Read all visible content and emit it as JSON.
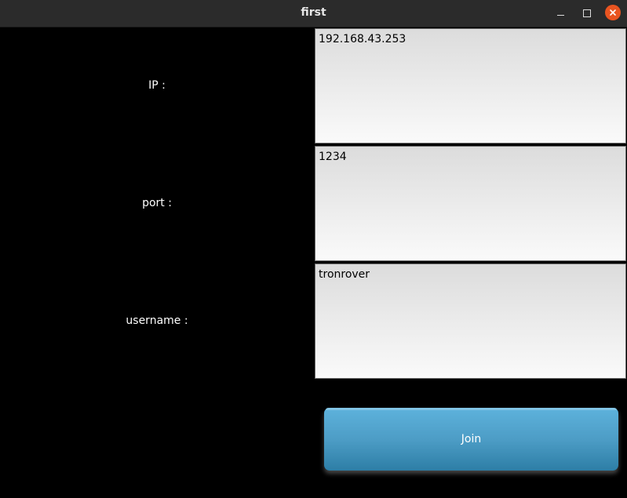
{
  "window": {
    "title": "first"
  },
  "form": {
    "ip_label": "IP :",
    "ip_value": "192.168.43.253",
    "port_label": "port :",
    "port_value": "1234",
    "username_label": "username :",
    "username_value": "tronrover",
    "join_label": "Join"
  },
  "colors": {
    "close_button": "#e95420",
    "join_button": "#4d9dc6",
    "background": "#000000"
  },
  "icons": {
    "minimize": "minimize-icon",
    "maximize": "maximize-icon",
    "close": "close-icon"
  }
}
